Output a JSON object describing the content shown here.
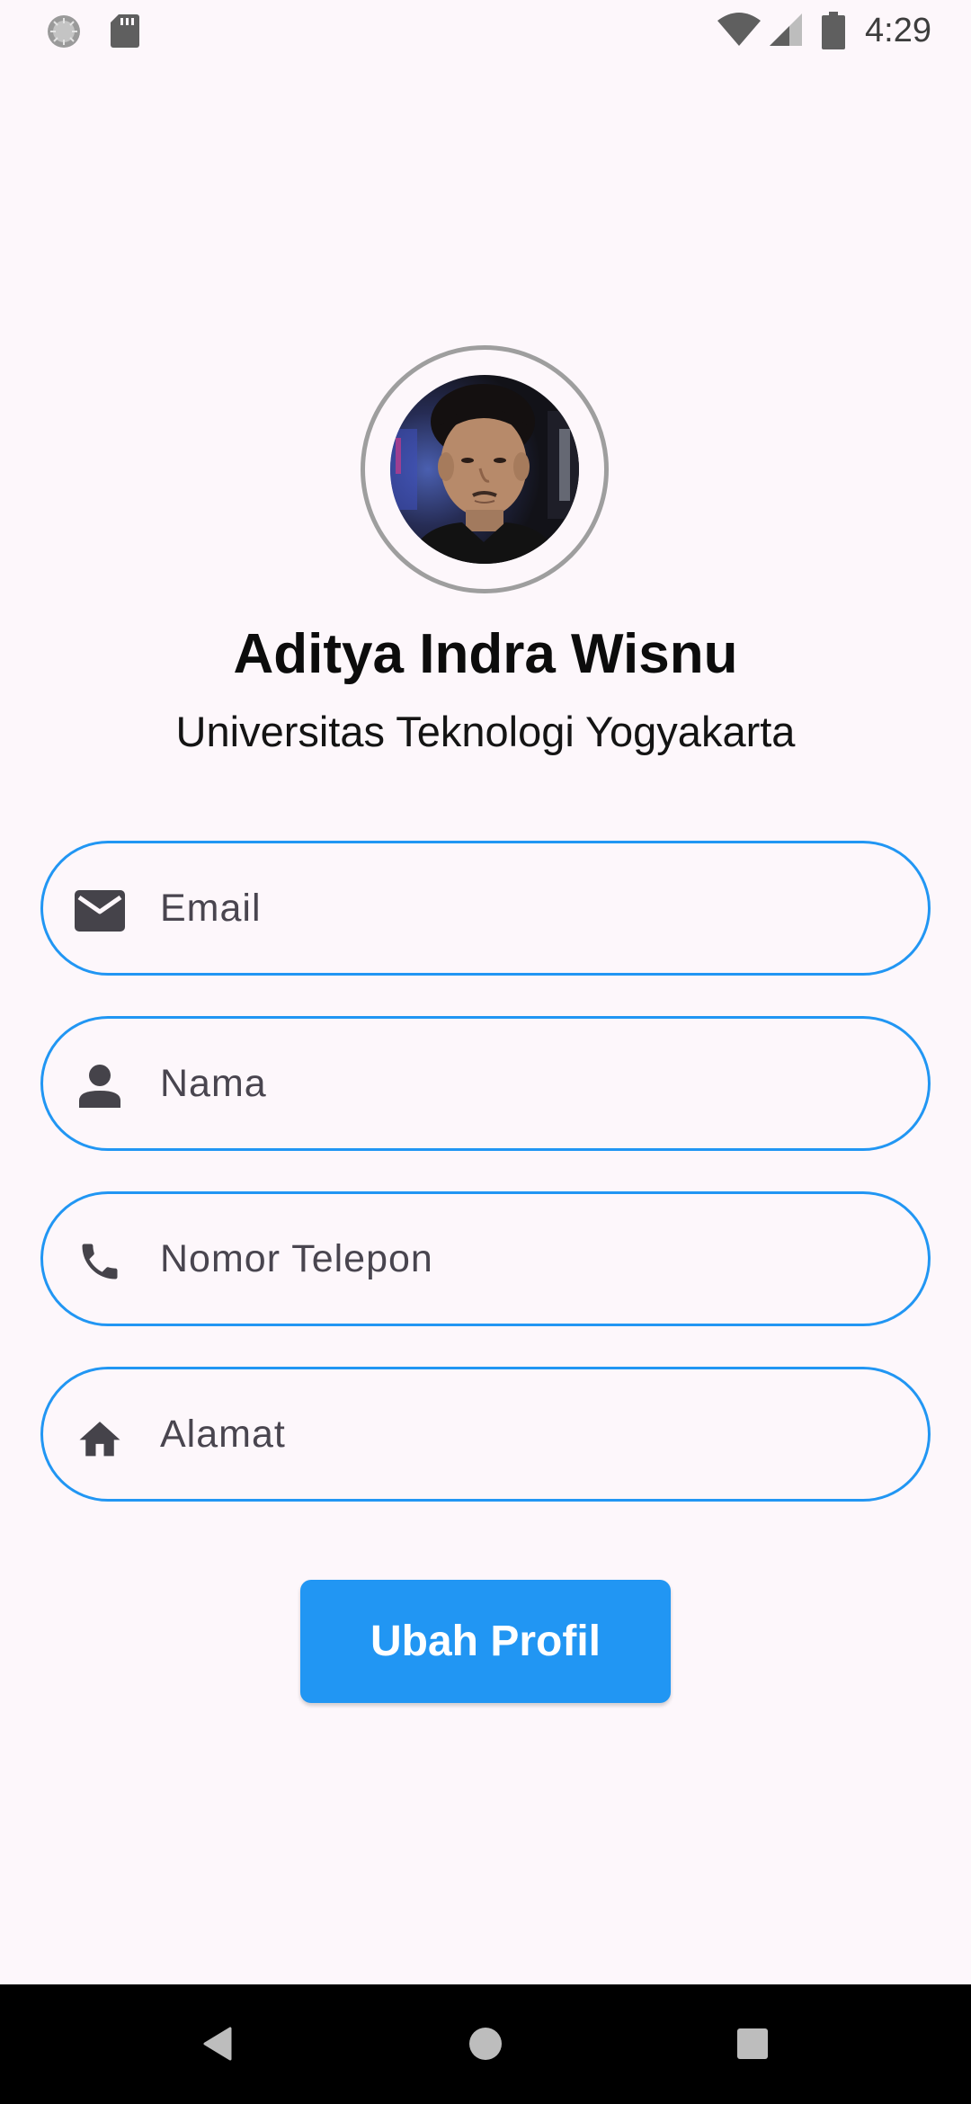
{
  "status_bar": {
    "time": "4:29",
    "left_icons": [
      "loading-circle-icon",
      "sd-card-icon"
    ],
    "right_icons": [
      "wifi-icon",
      "signal-icon",
      "battery-icon"
    ]
  },
  "profile": {
    "name": "Aditya Indra Wisnu",
    "university": "Universitas Teknologi Yogyakarta",
    "avatar_icon": "profile-photo"
  },
  "form": {
    "email": {
      "placeholder": "Email",
      "value": "",
      "icon": "mail-icon"
    },
    "name": {
      "placeholder": "Nama",
      "value": "",
      "icon": "person-icon"
    },
    "phone": {
      "placeholder": "Nomor Telepon",
      "value": "",
      "icon": "phone-icon"
    },
    "address": {
      "placeholder": "Alamat",
      "value": "",
      "icon": "home-icon"
    },
    "border_color": "#2196f3"
  },
  "actions": {
    "submit_label": "Ubah Profil",
    "button_color": "#2196f3"
  },
  "nav_bar": {
    "buttons": [
      "back-icon",
      "home-circle-icon",
      "recents-square-icon"
    ]
  }
}
